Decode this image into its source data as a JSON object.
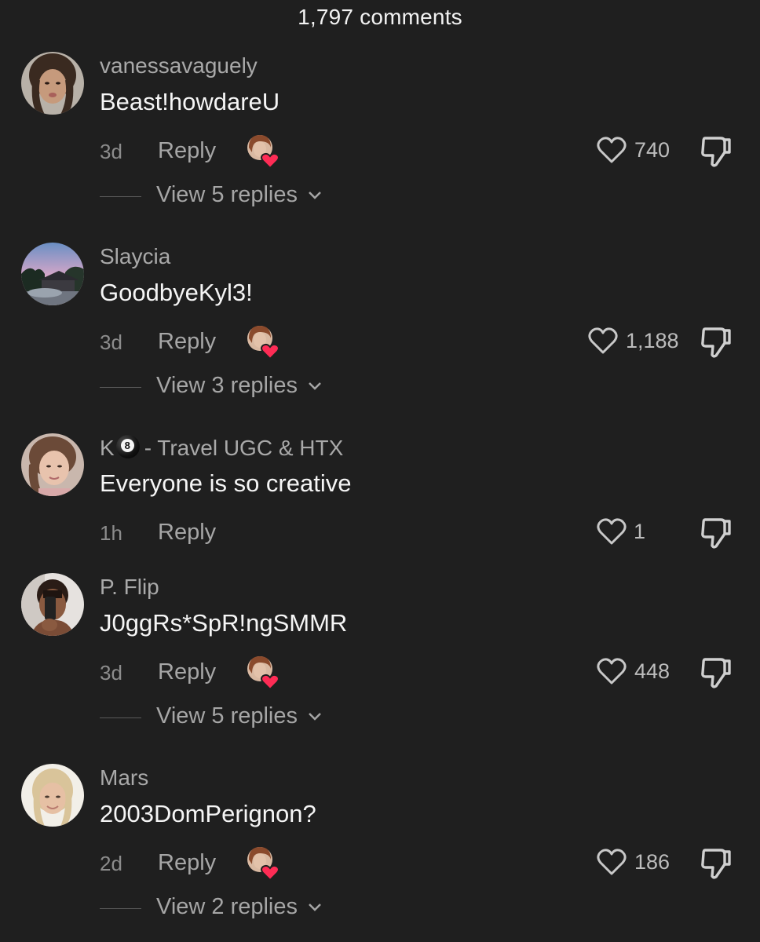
{
  "header": {
    "comment_count": "1,797 comments"
  },
  "icons": {
    "like": "heart-outline-icon",
    "dislike": "thumbs-down-icon",
    "creator_liked": "creator-heart-avatar-icon",
    "expand": "chevron-down-icon"
  },
  "colors": {
    "background": "#1f1f1f",
    "creator_heart": "#fe2c55",
    "muted_text": "#a6a6a6"
  },
  "comments": [
    {
      "username": "vanessavaguely",
      "text": "Beast!howdareU",
      "time": "3d",
      "reply_label": "Reply",
      "creator_liked": true,
      "likes": "740",
      "replies_label": "View 5 replies"
    },
    {
      "username": "Slaycia",
      "text": "GoodbyeKyl3!",
      "time": "3d",
      "reply_label": "Reply",
      "creator_liked": true,
      "likes": "1,188",
      "replies_label": "View 3 replies"
    },
    {
      "username_prefix": "K",
      "username_emoji": "8",
      "username_suffix": "- Travel UGC & HTX",
      "text": "Everyone is so creative",
      "time": "1h",
      "reply_label": "Reply",
      "creator_liked": false,
      "likes": "1"
    },
    {
      "username": "P. Flip",
      "text": "J0ggRs*SpR!ngSMMR",
      "time": "3d",
      "reply_label": "Reply",
      "creator_liked": true,
      "likes": "448",
      "replies_label": "View 5 replies"
    },
    {
      "username": "Mars",
      "text": "2003DomPerignon?",
      "time": "2d",
      "reply_label": "Reply",
      "creator_liked": true,
      "likes": "186",
      "replies_label": "View 2 replies"
    }
  ]
}
